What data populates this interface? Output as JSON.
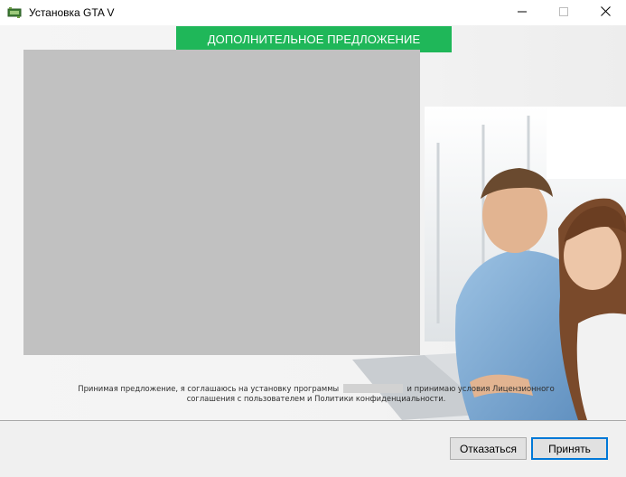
{
  "window": {
    "title": "Установка GTA V",
    "controls": {
      "minimize_icon": "minimize-icon",
      "maximize_icon": "maximize-icon",
      "close_icon": "close-icon"
    }
  },
  "offer": {
    "banner_text": "ДОПОЛНИТЕЛЬНОЕ ПРЕДЛОЖЕНИЕ",
    "banner_color": "#1fb759",
    "consent_line1_before": "Принимая предложение, я соглашаюсь на установку программы",
    "consent_line1_after": "и принимаю условия Лицензионного",
    "consent_line2": "соглашения с пользователем и Политики конфиденциальности."
  },
  "buttons": {
    "decline_label": "Отказаться",
    "accept_label": "Принять",
    "accent_color": "#0078d7"
  }
}
